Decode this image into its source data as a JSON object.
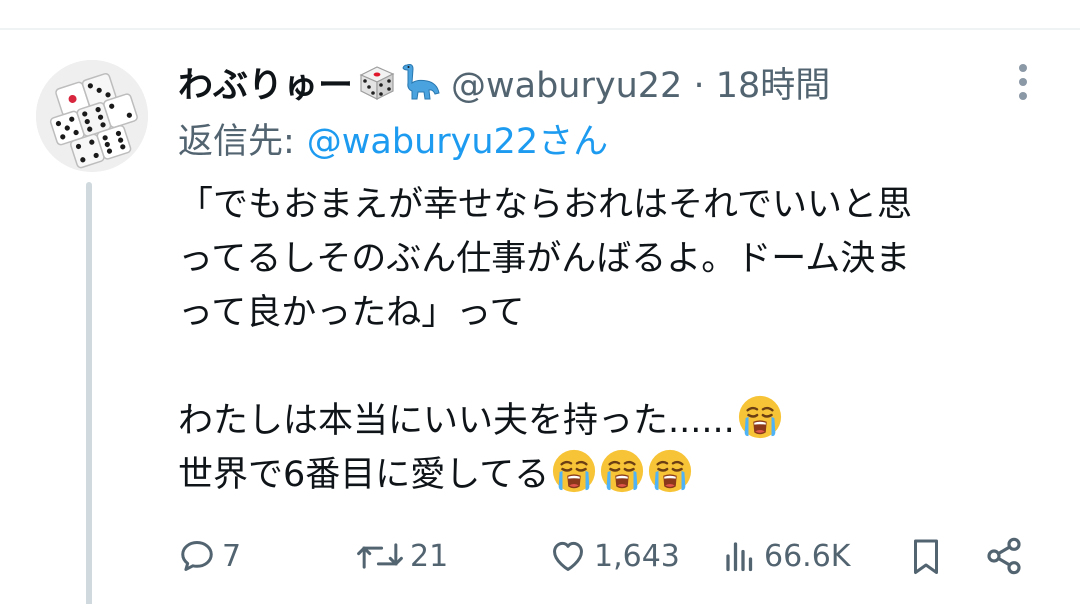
{
  "tweet": {
    "display_name": "わぶりゅー",
    "name_emojis": [
      "dice-emoji",
      "sauropod-emoji"
    ],
    "handle": "@waburyu22",
    "separator": "·",
    "time": "18時間",
    "reply_label": "返信先:",
    "reply_handle": "@waburyu22さん",
    "body": {
      "line1": "「でもおまえが幸せならおれはそれでいいと思",
      "line2": "ってるしそのぶん仕事がんばるよ。ドーム決ま",
      "line3": "って良かったね」って",
      "line4": "わたしは本当にいい夫を持った......",
      "line5": "世界で6番目に愛してる"
    },
    "body_emojis": [
      "loudly-crying-face-emoji"
    ]
  },
  "actions": {
    "reply_count": "7",
    "retweet_count": "21",
    "like_count": "1,643",
    "view_count": "66.6K"
  },
  "icons": [
    "avatar-dice",
    "more-vertical-icon",
    "reply-icon",
    "retweet-icon",
    "like-icon",
    "views-icon",
    "bookmark-icon",
    "share-icon"
  ],
  "colors": {
    "text_primary": "#0f1419",
    "text_secondary": "#536471",
    "link": "#1d9bf0",
    "thread_line": "#cfd9de"
  }
}
